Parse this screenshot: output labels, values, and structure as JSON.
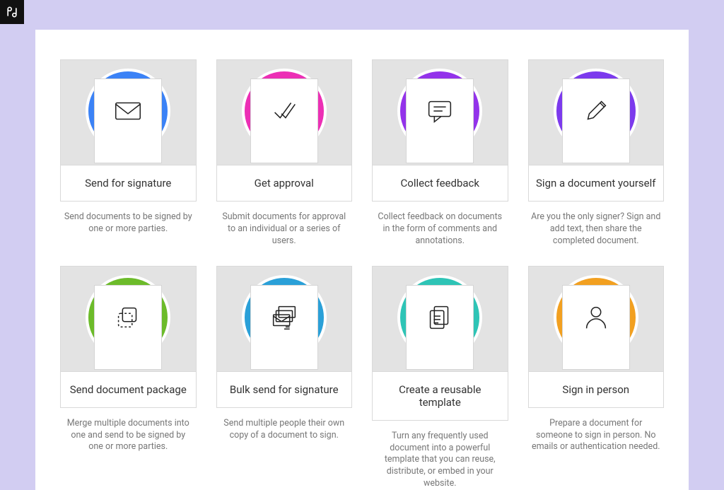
{
  "cards": [
    {
      "id": "send-for-signature",
      "icon": "envelope-icon",
      "accent": "blue",
      "title": "Send for signature",
      "description": "Send documents to be signed by one or more parties."
    },
    {
      "id": "get-approval",
      "icon": "double-check-icon",
      "accent": "pink",
      "title": "Get approval",
      "description": "Submit documents for approval to an individual or a series of users."
    },
    {
      "id": "collect-feedback",
      "icon": "comment-icon",
      "accent": "purple",
      "title": "Collect feedback",
      "description": "Collect feedback on documents in the form of comments and annotations."
    },
    {
      "id": "sign-yourself",
      "icon": "pencil-icon",
      "accent": "violet",
      "title": "Sign a document yourself",
      "description": "Are you the only signer? Sign and add text, then share the completed document."
    },
    {
      "id": "document-package",
      "icon": "layers-dashed-icon",
      "accent": "green",
      "title": "Send document package",
      "description": "Merge multiple documents into one and send to be signed by one or more parties."
    },
    {
      "id": "bulk-send",
      "icon": "stacked-envelopes-icon",
      "accent": "skyblue",
      "title": "Bulk send for signature",
      "description": "Send multiple people their own copy of a document to sign."
    },
    {
      "id": "reusable-template",
      "icon": "template-icon",
      "accent": "teal",
      "title": "Create a reusable template",
      "description": "Turn any frequently used document into a powerful template that you can reuse, distribute, or embed in your website."
    },
    {
      "id": "sign-in-person",
      "icon": "person-icon",
      "accent": "orange",
      "title": "Sign in person",
      "description": "Prepare a document for someone to sign in person. No emails or authentication needed."
    }
  ]
}
